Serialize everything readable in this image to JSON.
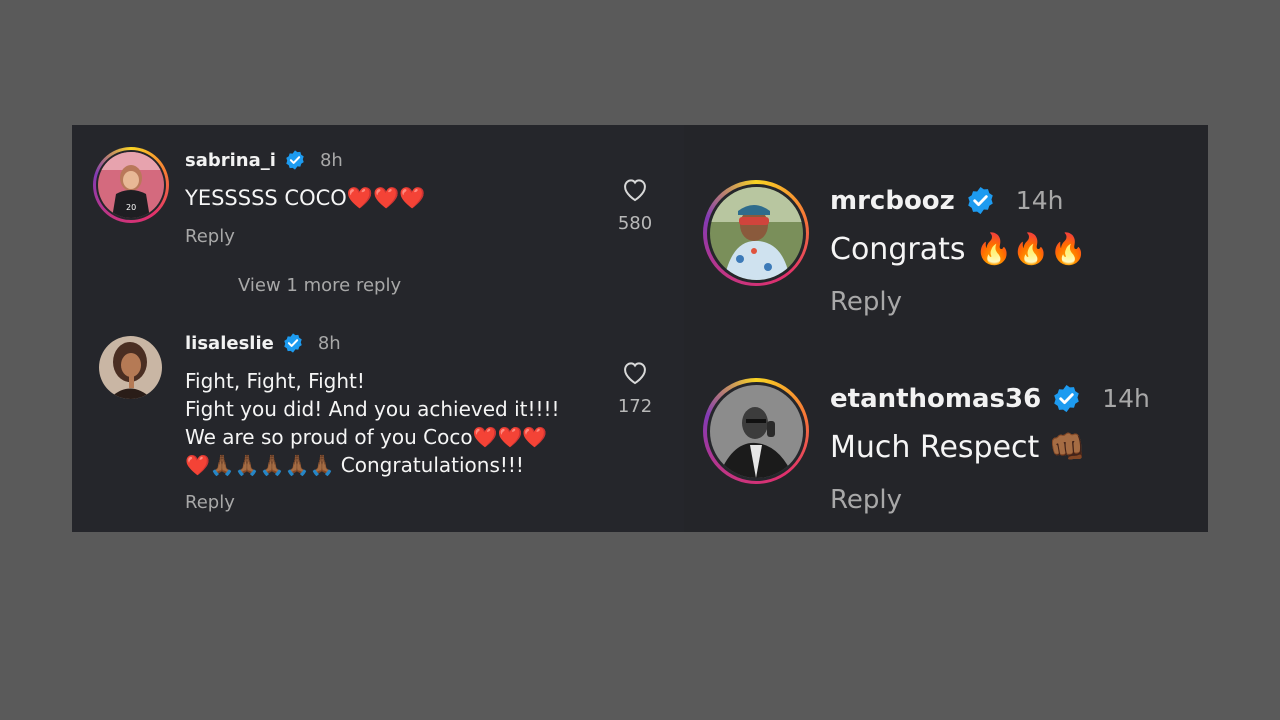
{
  "left": {
    "comments": [
      {
        "username": "sabrina_i",
        "time": "8h",
        "lines": [
          "YESSSSS COCO❤️❤️❤️"
        ],
        "reply": "Reply",
        "likes": "580",
        "view_more": "View 1 more reply"
      },
      {
        "username": "lisaleslie",
        "time": "8h",
        "lines": [
          "Fight, Fight, Fight!",
          "Fight you did! And you achieved it!!!!",
          "We are so proud of you Coco❤️❤️❤️",
          "❤️🙏🏾🙏🏾🙏🏾🙏🏾🙏🏾 Congratulations!!!"
        ],
        "reply": "Reply",
        "likes": "172"
      }
    ]
  },
  "right": {
    "comments": [
      {
        "username": "mrcbooz",
        "time": "14h",
        "text": "Congrats 🔥🔥🔥",
        "reply": "Reply"
      },
      {
        "username": "etanthomas36",
        "time": "14h",
        "text": "Much Respect 👊🏾",
        "reply": "Reply"
      }
    ]
  },
  "colors": {
    "panel": "#25262b",
    "verified": "#1d9bf0",
    "muted": "#a8a8a8",
    "background": "#5a5a5a"
  }
}
